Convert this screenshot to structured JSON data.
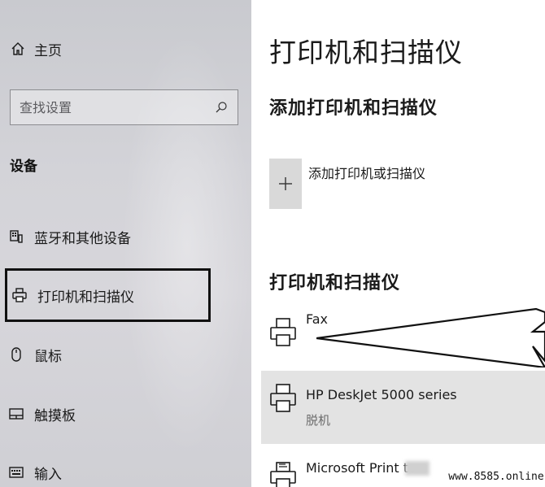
{
  "sidebar": {
    "home": {
      "label": "主页",
      "icon": "home-icon"
    },
    "search": {
      "placeholder": "查找设置",
      "icon": "search-icon"
    },
    "section_title": "设备",
    "items": [
      {
        "label": "蓝牙和其他设备",
        "icon": "bluetooth-devices-icon",
        "selected": false
      },
      {
        "label": "打印机和扫描仪",
        "icon": "printer-icon",
        "selected": true
      },
      {
        "label": "鼠标",
        "icon": "mouse-icon",
        "selected": false
      },
      {
        "label": "触摸板",
        "icon": "touchpad-icon",
        "selected": false
      },
      {
        "label": "输入",
        "icon": "keyboard-icon",
        "selected": false
      }
    ]
  },
  "main": {
    "title": "打印机和扫描仪",
    "add_section_title": "添加打印机和扫描仪",
    "add_button": {
      "label": "添加打印机或扫描仪",
      "icon": "plus-icon"
    },
    "list_title": "打印机和扫描仪",
    "devices": [
      {
        "name": "Fax",
        "status": "",
        "icon": "printer-icon",
        "selected": false
      },
      {
        "name": "HP DeskJet 5000 series",
        "status": "脱机",
        "icon": "printer-icon",
        "selected": true
      },
      {
        "name": "Microsoft Print to",
        "status": "",
        "icon": "pdf-printer-icon",
        "selected": false
      }
    ]
  },
  "watermark": "www.8585.online",
  "colors": {
    "sidebar_bg": "#d3d3d8",
    "selected_row": "#e3e3e3",
    "add_button_bg": "#d9d9d9",
    "selection_border": "#111111"
  }
}
